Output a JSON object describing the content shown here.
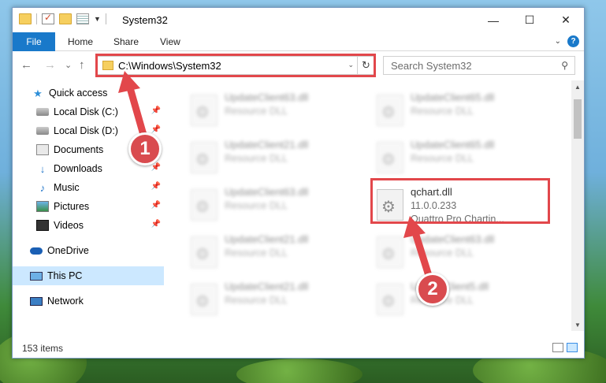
{
  "window": {
    "title": "System32",
    "controls": {
      "minimize": "—",
      "maximize": "☐",
      "close": "✕"
    }
  },
  "ribbon": {
    "tabs": [
      "File",
      "Home",
      "Share",
      "View"
    ],
    "expand_icon": "chevron-down-icon",
    "help_label": "?"
  },
  "nav": {
    "back": "←",
    "forward": "→",
    "recent": "⌄",
    "up": "↑",
    "address": "C:\\Windows\\System32",
    "search_placeholder": "Search System32"
  },
  "sidebar": {
    "items": [
      {
        "label": "Quick access",
        "icon": "star-icon",
        "pinned": false
      },
      {
        "label": "Local Disk (C:)",
        "icon": "drive-icon",
        "pinned": true
      },
      {
        "label": "Local Disk (D:)",
        "icon": "drive-icon",
        "pinned": true
      },
      {
        "label": "Documents",
        "icon": "documents-icon",
        "pinned": true
      },
      {
        "label": "Downloads",
        "icon": "downloads-icon",
        "pinned": true
      },
      {
        "label": "Music",
        "icon": "music-icon",
        "pinned": true
      },
      {
        "label": "Pictures",
        "icon": "pictures-icon",
        "pinned": true
      },
      {
        "label": "Videos",
        "icon": "videos-icon",
        "pinned": true
      },
      {
        "label": "OneDrive",
        "icon": "onedrive-icon",
        "pinned": false
      },
      {
        "label": "This PC",
        "icon": "this-pc-icon",
        "pinned": false,
        "selected": true
      },
      {
        "label": "Network",
        "icon": "network-icon",
        "pinned": false
      }
    ]
  },
  "files": [
    {
      "name": "UpdateClient63.dll",
      "desc": "Resource DLL",
      "blurred": true
    },
    {
      "name": "UpdateClient65.dll",
      "desc": "Resource DLL",
      "blurred": true
    },
    {
      "name": "UpdateClient21.dll",
      "desc": "Resource DLL",
      "blurred": true
    },
    {
      "name": "UpdateClient65.dll",
      "desc": "Resource DLL",
      "blurred": true
    },
    {
      "name": "UpdateClient63.dll",
      "desc": "Resource DLL",
      "blurred": true
    },
    {
      "name": "qchart.dll",
      "version": "11.0.0.233",
      "desc": "Quattro Pro Chartin...",
      "blurred": false
    },
    {
      "name": "UpdateClient21.dll",
      "desc": "Resource DLL",
      "blurred": true
    },
    {
      "name": "UpdateClient63.dll",
      "desc": "Resource DLL",
      "blurred": true
    },
    {
      "name": "UpdateClient21.dll",
      "desc": "Resource DLL",
      "blurred": true
    },
    {
      "name": "UpdateClient5.dll",
      "desc": "Resource DLL",
      "blurred": true
    }
  ],
  "status": {
    "item_count": "153 items"
  },
  "annotations": {
    "step1": "1",
    "step2": "2",
    "color": "#e2474b"
  }
}
